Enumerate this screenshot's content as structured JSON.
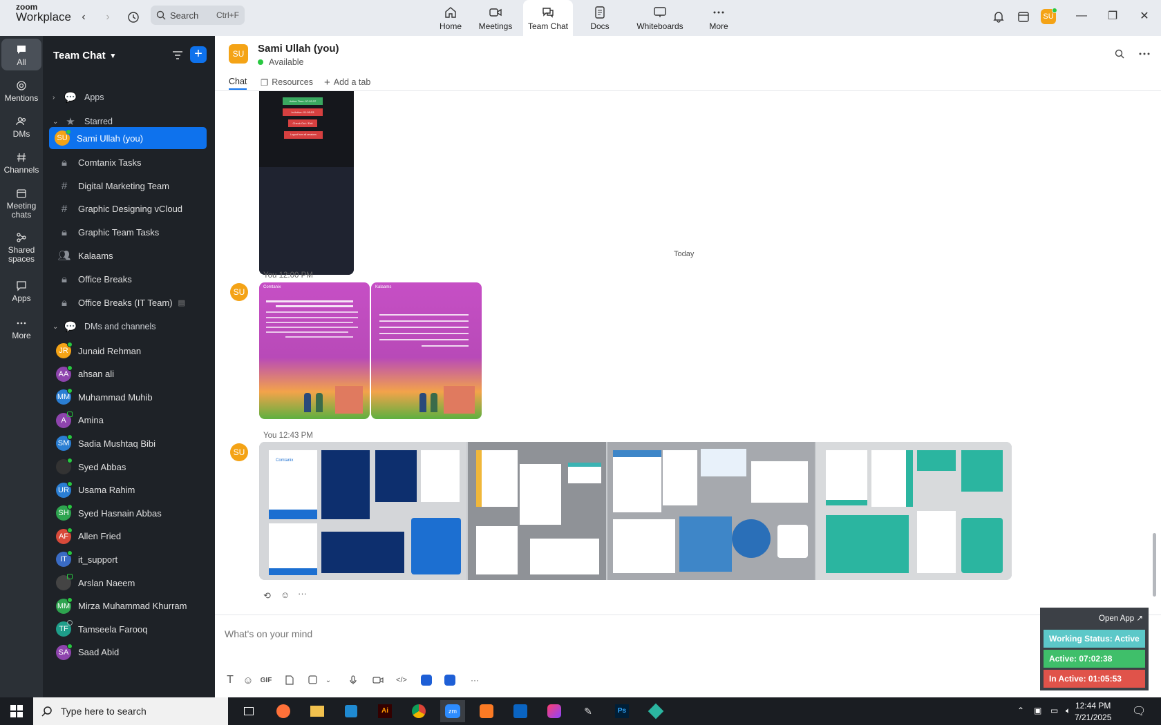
{
  "app": {
    "brand_line1": "zoom",
    "brand_line2": "Workplace"
  },
  "search": {
    "label": "Search",
    "shortcut": "Ctrl+F"
  },
  "topnav": [
    {
      "label": "Home"
    },
    {
      "label": "Meetings"
    },
    {
      "label": "Team Chat"
    },
    {
      "label": "Docs"
    },
    {
      "label": "Whiteboards"
    },
    {
      "label": "More"
    }
  ],
  "user": {
    "initials": "SU"
  },
  "rail": [
    {
      "label": "All"
    },
    {
      "label": "Mentions"
    },
    {
      "label": "DMs"
    },
    {
      "label": "Channels"
    },
    {
      "label": "Meeting chats"
    },
    {
      "label": "Shared spaces"
    },
    {
      "label": "Apps"
    },
    {
      "label": "More"
    }
  ],
  "sidebar": {
    "title": "Team Chat",
    "apps_section": "Apps",
    "starred_section": "Starred",
    "starred": [
      {
        "label": "Sami Ullah (you)",
        "initials": "SU"
      },
      {
        "label": "Comtanix Tasks"
      },
      {
        "label": "Digital Marketing Team"
      },
      {
        "label": "Graphic Designing vCloud"
      },
      {
        "label": "Graphic Team Tasks"
      },
      {
        "label": "Kalaams"
      },
      {
        "label": "Office Breaks"
      },
      {
        "label": "Office Breaks (IT Team)"
      }
    ],
    "dms_section": "DMs and channels",
    "dms": [
      {
        "label": "Junaid Rehman",
        "initials": "JR"
      },
      {
        "label": "ahsan ali",
        "initials": "AA"
      },
      {
        "label": "Muhammad Muhib",
        "initials": "MM"
      },
      {
        "label": "Amina",
        "initials": "A"
      },
      {
        "label": "Sadia Mushtaq Bibi",
        "initials": "SM"
      },
      {
        "label": "Syed Abbas",
        "initials": ""
      },
      {
        "label": "Usama Rahim",
        "initials": "UR"
      },
      {
        "label": "Syed Hasnain Abbas",
        "initials": "SH"
      },
      {
        "label": "Allen Fried",
        "initials": "AF"
      },
      {
        "label": "it_support",
        "initials": "IT"
      },
      {
        "label": "Arslan Naeem",
        "initials": ""
      },
      {
        "label": "Mirza Muhammad Khurram",
        "initials": "MM"
      },
      {
        "label": "Tamseela Farooq",
        "initials": "TF"
      },
      {
        "label": "Saad Abid",
        "initials": "SA"
      }
    ]
  },
  "chat": {
    "name": "Sami Ullah (you)",
    "initials": "SU",
    "status": "Available",
    "tabs": {
      "chat": "Chat",
      "resources": "Resources",
      "add": "Add a tab"
    },
    "date_separator": "Today",
    "messages": [
      {
        "sender": "You",
        "time": "12:00 PM"
      },
      {
        "sender": "You",
        "time": "12:43 PM"
      }
    ],
    "old_image_text": [
      "Active Time: 07:02:37",
      "In Active: 01:05:53",
      "Check Out / Exit",
      "Logout from all sessions"
    ],
    "brand_text": "Comtanix",
    "post_brand": "Kalaams",
    "composer_placeholder": "What's on your mind"
  },
  "status_widget": {
    "open_app": "Open App ↗",
    "working": "Working Status: Active",
    "active": "Active: 07:02:38",
    "inactive": "In Active: 01:05:53"
  },
  "taskbar": {
    "search_placeholder": "Type here to search",
    "time": "12:44 PM",
    "date": "7/21/2025"
  },
  "colors": {
    "accent": "#0e72ed",
    "online": "#28c840",
    "avatar_orange": "#f4a316",
    "status_active": "#5cc8c8",
    "status_time": "#3fbf6a",
    "status_inactive": "#e0534a"
  }
}
